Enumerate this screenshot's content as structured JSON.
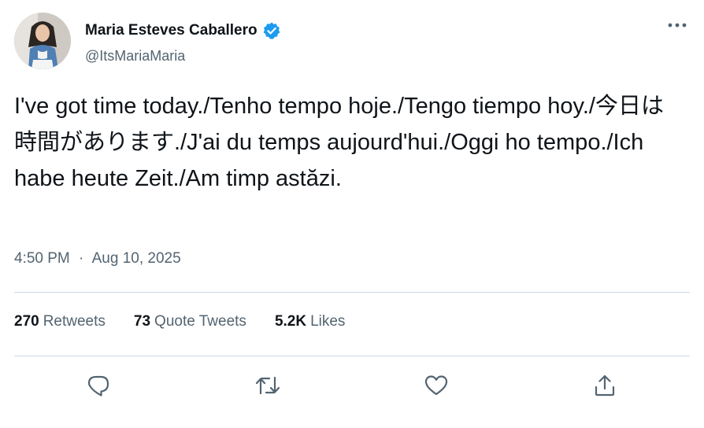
{
  "author": {
    "display_name": "Maria Esteves Caballero",
    "handle": "@ItsMariaMaria",
    "verified": true
  },
  "tweet": {
    "text": "I've got time today./Tenho tempo hoje./Tengo tiempo hoy./今日は時間があります./J'ai du temps aujourd'hui./Oggi ho tempo./Ich habe heute Zeit./Am timp astăzi."
  },
  "meta": {
    "time": "4:50 PM",
    "separator": "·",
    "date": "Aug 10, 2025"
  },
  "stats": {
    "retweets": {
      "count": "270",
      "label": "Retweets"
    },
    "quote_tweets": {
      "count": "73",
      "label": "Quote Tweets"
    },
    "likes": {
      "count": "5.2K",
      "label": "Likes"
    }
  },
  "actions": [
    {
      "name": "reply",
      "icon": "reply-icon"
    },
    {
      "name": "retweet",
      "icon": "retweet-icon"
    },
    {
      "name": "like",
      "icon": "heart-icon"
    },
    {
      "name": "share",
      "icon": "share-icon"
    }
  ],
  "colors": {
    "verified_badge": "#1d9bf0",
    "secondary_text": "#536471",
    "primary_text": "#0f1419",
    "divider": "#cfd9de"
  }
}
